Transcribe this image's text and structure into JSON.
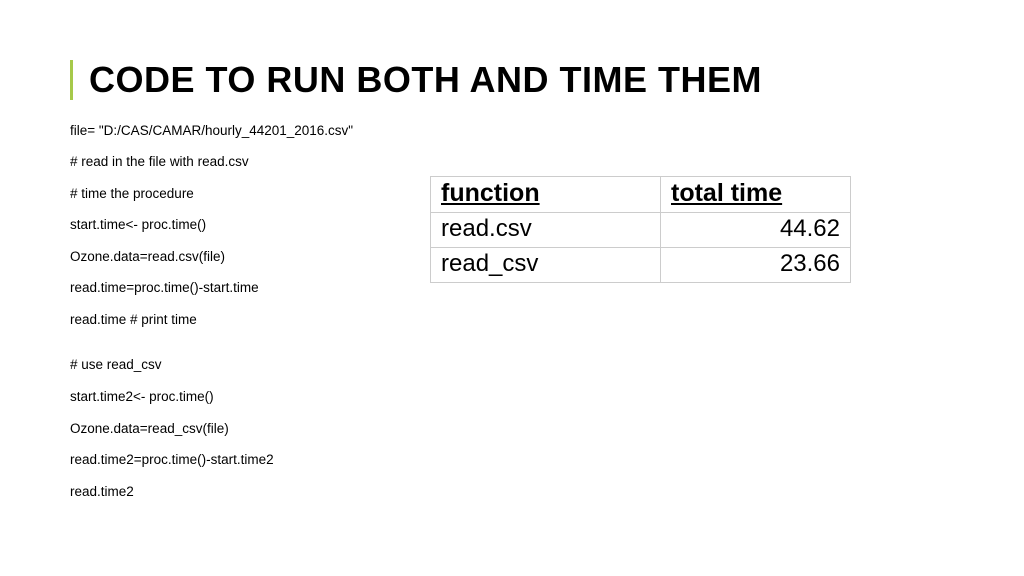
{
  "title": "CODE TO RUN BOTH AND TIME THEM",
  "code_lines": [
    "file= \"D:/CAS/CAMAR/hourly_44201_2016.csv\"",
    "# read in the file with read.csv",
    "# time the procedure",
    "start.time<- proc.time()",
    "Ozone.data=read.csv(file)",
    "read.time=proc.time()-start.time",
    "read.time # print time",
    "",
    "# use read_csv",
    "start.time2<- proc.time()",
    "Ozone.data=read_csv(file)",
    "read.time2=proc.time()-start.time2",
    "read.time2"
  ],
  "table": {
    "headers": {
      "function": "function",
      "total_time": "total time"
    },
    "rows": [
      {
        "function": "read.csv",
        "time": "44.62"
      },
      {
        "function": "read_csv",
        "time": "23.66"
      }
    ]
  }
}
